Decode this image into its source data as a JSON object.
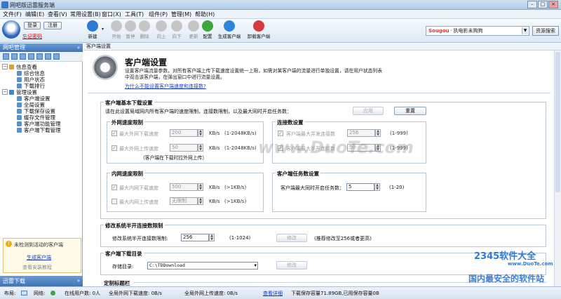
{
  "title": "网吧版迅雷服务端",
  "menu": [
    "文件(F)",
    "编辑(E)",
    "查看(V)",
    "常用设置(B)",
    "窗口(X)",
    "工具(T)",
    "组件(P)",
    "管理(M)",
    "帮助(H)"
  ],
  "account": {
    "login": "登录",
    "register": "注册",
    "forgot": "忘记密码"
  },
  "toolbar": [
    {
      "label": "新建",
      "enabled": true
    },
    {
      "label": "开始",
      "enabled": false
    },
    {
      "label": "暂停",
      "enabled": false
    },
    {
      "label": "删除",
      "enabled": false
    },
    {
      "label": "向上",
      "enabled": false
    },
    {
      "label": "向下",
      "enabled": false
    },
    {
      "label": "更新",
      "enabled": false
    },
    {
      "label": "配置",
      "enabled": true
    },
    {
      "label": "生成客户端",
      "enabled": true
    },
    {
      "label": "卸载客户端",
      "enabled": true
    }
  ],
  "search": {
    "brand": "Sougou",
    "value": "· 执电影未购狗",
    "button": "资源搜索"
  },
  "sidebar": {
    "header": "网吧管理",
    "tree": [
      {
        "label": "信息查看",
        "level": 0,
        "expander": "−"
      },
      {
        "label": "综合信息",
        "level": 1
      },
      {
        "label": "用户状态",
        "level": 1
      },
      {
        "label": "下载排行",
        "level": 1
      },
      {
        "label": "管理设置",
        "level": 0,
        "expander": "−"
      },
      {
        "label": "客户端设置",
        "level": 1
      },
      {
        "label": "全局设置",
        "level": 1
      },
      {
        "label": "下载保存设置",
        "level": 1
      },
      {
        "label": "缓存文件管理",
        "level": 1
      },
      {
        "label": "客户端功能管理",
        "level": 1
      },
      {
        "label": "客户端下载管理",
        "level": 1
      }
    ],
    "notice": {
      "text": "未检测到活动的客户端",
      "link": "生成客户端",
      "link2": "查看安装教程"
    },
    "footer": "迅雷下载"
  },
  "breadcrumb": "客户端设置",
  "page": {
    "title": "客户端设置",
    "desc1": "设置客户端流量参数，对所有客户端上传下载速度设置统一上限，如需对某客户端的流量进行单独设置，请在用户状态列表",
    "desc2": "中双击该客户端，在弹出窗口中进行流量设置。",
    "help_link": "为什么不能设置客户端速度和连接数?"
  },
  "basic": {
    "legend": "客户端基本下载设置",
    "desc": "请在此设置局域网内所有客户端的速度限制，连接数限制，以及最大同时开启任务数：",
    "apply": "应用",
    "reset": "重置",
    "wan": {
      "legend": "外网速度限制",
      "rows": [
        {
          "label": "最大外网下载速度",
          "value": "200",
          "unit": "KB/s",
          "range": "(1-2048KB/s)"
        },
        {
          "label": "最大外网上传速度",
          "value": "50",
          "unit": "KB/s",
          "range": "(1-2048KB/s)"
        }
      ],
      "note": "（客户端在下载时拉外网上传）"
    },
    "conn": {
      "legend": "连接数设置",
      "rows": [
        {
          "label": "客户端最大并发连接数",
          "value": "256",
          "range": "(1-999)"
        },
        {
          "label": "客户端最大半开连接数",
          "value": "50",
          "range": "(1-999)"
        }
      ]
    },
    "lan": {
      "legend": "内网速度限制",
      "rows": [
        {
          "label": "最大内网下载速度",
          "value": "500",
          "unit": "KB/s",
          "range": "(>1KB/s)"
        },
        {
          "label": "最大内网上传速度",
          "value": "无限制",
          "unit": "KB/s",
          "range": "(>1KB/s)"
        }
      ]
    },
    "tasks": {
      "legend": "客户端任务数设置",
      "label": "客户端最大同时开启任务数：",
      "value": "5",
      "range": "(1-20)"
    }
  },
  "tcp": {
    "legend": "修改系统半开连接数限制",
    "label": "修改系统半开连接数限制:",
    "value": "256",
    "range": "(1-1024)",
    "button": "修改",
    "hint": "(推荐修改至256或者更高)"
  },
  "dir": {
    "legend": "客户端下载目录",
    "label": "存储目录:",
    "value": "C:\\TDDownload",
    "button": "修改"
  },
  "custom": {
    "legend": "定制标题栏"
  },
  "status": {
    "layout": "布局:",
    "network": "网络:",
    "online": "在线用户数: 0人",
    "down": "全局外网下载速度: 0B/s",
    "up": "全局外网上传速度: 0B/s",
    "detail": "查看详细",
    "cache": "下载保存容量71.89GB,已用保存容量0B"
  },
  "watermarks": {
    "duote": "www.DuoTe.com",
    "brand": "2345软件大全",
    "brand_url": "www.DuoTe.com",
    "slogan": "国内最安全的软件站"
  },
  "colors": {
    "accent": "#3f73b6",
    "link": "#1a3ebf",
    "warning": "#f0b000"
  }
}
